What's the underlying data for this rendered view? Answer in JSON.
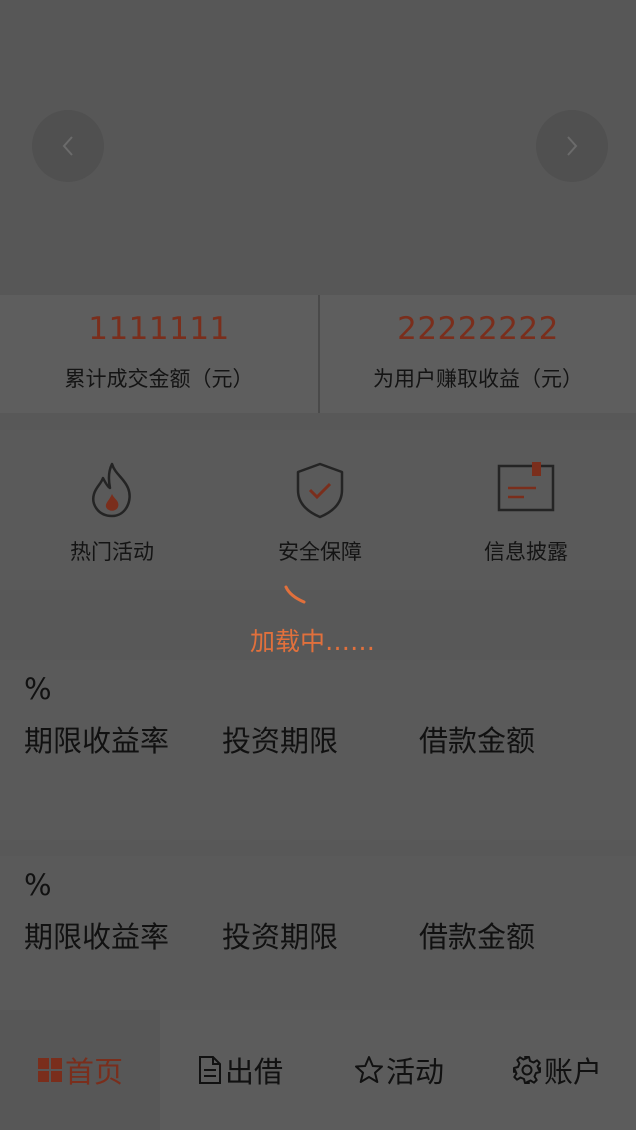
{
  "banner": {
    "prev_icon": "chevron-left-icon",
    "next_icon": "chevron-right-icon"
  },
  "stats": [
    {
      "value": "1111111",
      "label": "累计成交金额（元）"
    },
    {
      "value": "22222222",
      "label": "为用户赚取收益（元）"
    }
  ],
  "features": [
    {
      "label": "热门活动",
      "icon": "flame-icon"
    },
    {
      "label": "安全保障",
      "icon": "shield-check-icon"
    },
    {
      "label": "信息披露",
      "icon": "document-icon"
    }
  ],
  "loading": {
    "text": "加载中……"
  },
  "products": [
    {
      "percent": "%",
      "labels": [
        "期限收益率",
        "投资期限",
        "借款金额"
      ]
    },
    {
      "percent": "%",
      "labels": [
        "期限收益率",
        "投资期限",
        "借款金额"
      ]
    }
  ],
  "tabbar": {
    "tabs": [
      {
        "label": "首页",
        "icon": "grid-icon",
        "active": true
      },
      {
        "label": "出借",
        "icon": "file-icon",
        "active": false
      },
      {
        "label": "活动",
        "icon": "star-icon",
        "active": false
      },
      {
        "label": "账户",
        "icon": "gear-icon",
        "active": false
      }
    ]
  },
  "colors": {
    "accent": "#7a2e1c",
    "loading": "#e1703c",
    "overlay_bg": "#585858"
  }
}
